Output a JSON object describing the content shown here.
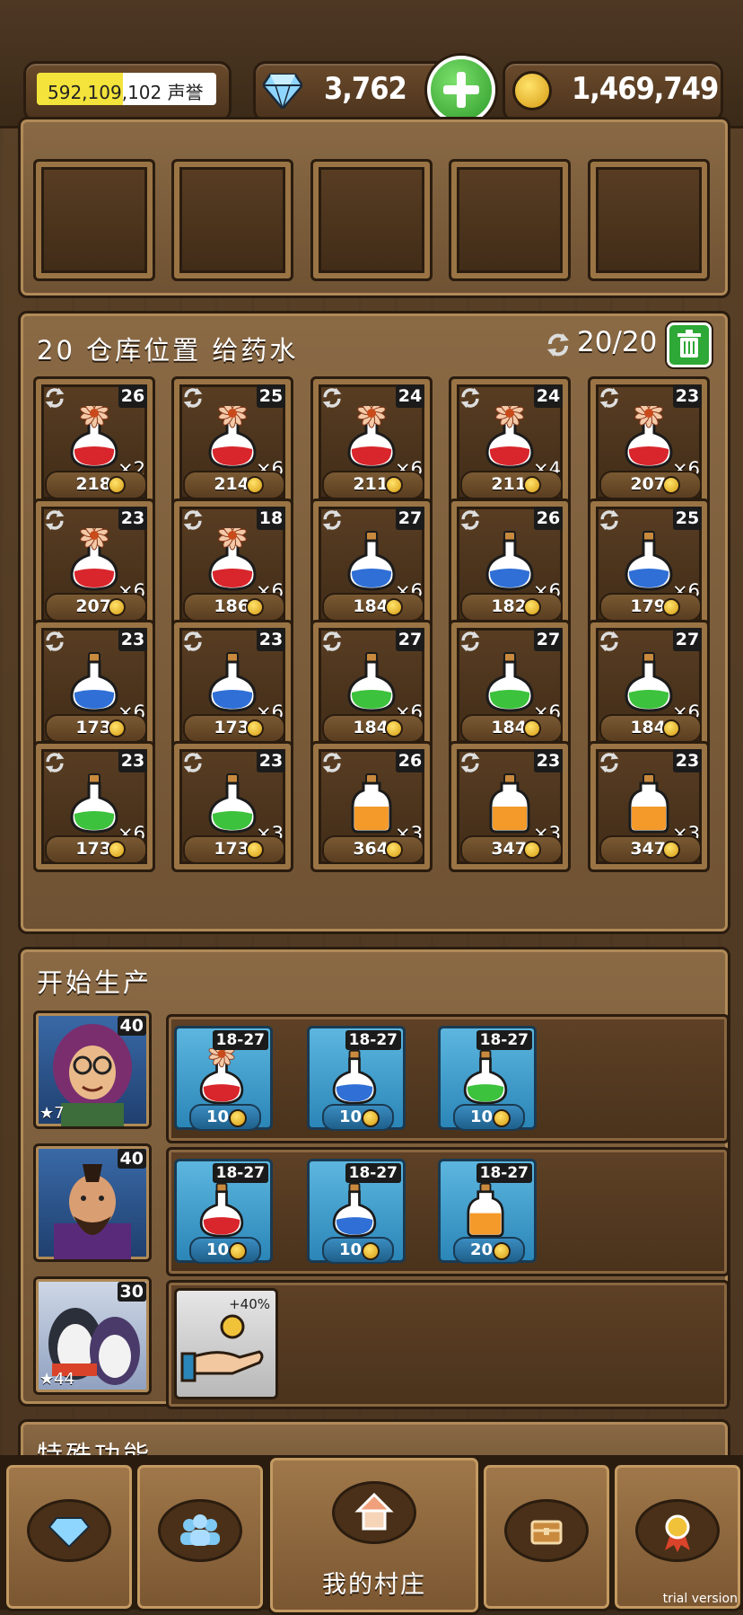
{
  "currency": {
    "reputation": "592,109,102 声誉",
    "reputation_progress": 0.48,
    "gems": "3,762",
    "gold": "1,469,749"
  },
  "warehouse": {
    "title": "20 仓库位置 给药水",
    "capacity": "20/20",
    "slots": [
      {
        "level": "26",
        "qty": "×2",
        "price": "218",
        "potion": "flower-red"
      },
      {
        "level": "25",
        "qty": "×6",
        "price": "214",
        "potion": "flower-red"
      },
      {
        "level": "24",
        "qty": "×6",
        "price": "211",
        "potion": "flower-red"
      },
      {
        "level": "24",
        "qty": "×4",
        "price": "211",
        "potion": "flower-red"
      },
      {
        "level": "23",
        "qty": "×6",
        "price": "207",
        "potion": "flower-red"
      },
      {
        "level": "23",
        "qty": "×6",
        "price": "207",
        "potion": "flower-red"
      },
      {
        "level": "18",
        "qty": "×6",
        "price": "186",
        "potion": "flower-red"
      },
      {
        "level": "27",
        "qty": "×6",
        "price": "184",
        "potion": "blue"
      },
      {
        "level": "26",
        "qty": "×6",
        "price": "182",
        "potion": "blue"
      },
      {
        "level": "25",
        "qty": "×6",
        "price": "179",
        "potion": "blue"
      },
      {
        "level": "23",
        "qty": "×6",
        "price": "173",
        "potion": "blue"
      },
      {
        "level": "23",
        "qty": "×6",
        "price": "173",
        "potion": "blue"
      },
      {
        "level": "27",
        "qty": "×6",
        "price": "184",
        "potion": "green"
      },
      {
        "level": "27",
        "qty": "×6",
        "price": "184",
        "potion": "green"
      },
      {
        "level": "27",
        "qty": "×6",
        "price": "184",
        "potion": "green"
      },
      {
        "level": "23",
        "qty": "×6",
        "price": "173",
        "potion": "green"
      },
      {
        "level": "23",
        "qty": "×3",
        "price": "173",
        "potion": "green"
      },
      {
        "level": "26",
        "qty": "×3",
        "price": "364",
        "potion": "orange"
      },
      {
        "level": "23",
        "qty": "×3",
        "price": "347",
        "potion": "orange"
      },
      {
        "level": "23",
        "qty": "×3",
        "price": "347",
        "potion": "orange"
      }
    ]
  },
  "production": {
    "title": "开始生产",
    "workers": [
      {
        "level": "40",
        "stars": "7",
        "recipes": [
          {
            "range": "18-27",
            "cost": "10",
            "potion": "flower-red"
          },
          {
            "range": "18-27",
            "cost": "10",
            "potion": "blue"
          },
          {
            "range": "18-27",
            "cost": "10",
            "potion": "green"
          }
        ]
      },
      {
        "level": "40",
        "stars": "",
        "recipes": [
          {
            "range": "18-27",
            "cost": "10",
            "potion": "red"
          },
          {
            "range": "18-27",
            "cost": "10",
            "potion": "blue"
          },
          {
            "range": "18-27",
            "cost": "20",
            "potion": "orange"
          }
        ]
      },
      {
        "level": "30",
        "stars": "44",
        "boost": "+40%"
      }
    ]
  },
  "special": {
    "title": "特殊功能"
  },
  "nav": {
    "village_label": "我的村庄",
    "trial": "trial version"
  },
  "colors": {
    "red": "#d8262c",
    "blue": "#2f6fd6",
    "green": "#3cc23c",
    "orange": "#f39a2a"
  }
}
